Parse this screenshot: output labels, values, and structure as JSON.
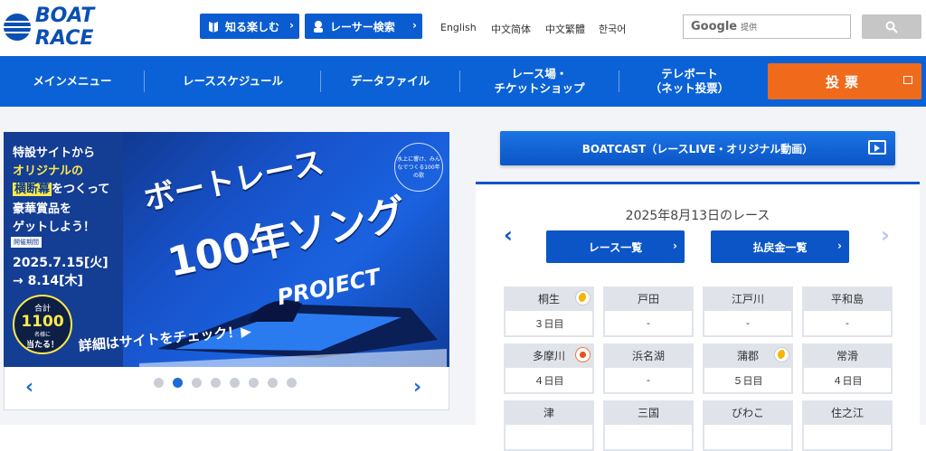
{
  "header": {
    "logo_text": "BOAT RACE",
    "btn_knowledge": "知る楽しむ",
    "btn_racer": "レーサー検索",
    "languages": [
      "English",
      "中文简体",
      "中文繁體",
      "한국어"
    ],
    "search_brand": "Google",
    "search_provided": "提供"
  },
  "nav": {
    "items": [
      "メインメニュー",
      "レーススケジュール",
      "データファイル",
      "レース場・\nチケットショップ",
      "テレボート\n（ネット投票）"
    ],
    "vote": "投票"
  },
  "banner": {
    "line1": "特設サイトから",
    "line2": "オリジナルの",
    "line3a": "横断幕",
    "line3b": "をつくって",
    "line4": "豪華賞品を",
    "line5": "ゲットしよう！",
    "period_label": "開催期間",
    "date_start": "2025.7.15[火]",
    "date_end": "→ 8.14[木]",
    "circle_top": "合計",
    "circle_num": "1100",
    "circle_unit": "名様に",
    "circle_bottom": "当たる！",
    "title1": "ボートレース",
    "title2": "100年ソング",
    "title3": "PROJECT",
    "link": "詳細はサイトをチェック！▶",
    "badge": "水上に響け、みんなでつくる100年の歌",
    "slide_count": 8,
    "active_slide": 2
  },
  "boatcast": "BOATCAST（レースLIVE・オリジナル動画）",
  "races": {
    "date_title": "2025年8月13日のレース",
    "btn_list": "レース一覧",
    "btn_payout": "払戻金一覧",
    "venues": [
      {
        "name": "桐生",
        "day": "３日目",
        "icon": "moon"
      },
      {
        "name": "戸田",
        "day": "-",
        "icon": ""
      },
      {
        "name": "江戸川",
        "day": "-",
        "icon": ""
      },
      {
        "name": "平和島",
        "day": "-",
        "icon": ""
      },
      {
        "name": "多摩川",
        "day": "４日目",
        "icon": "sun"
      },
      {
        "name": "浜名湖",
        "day": "-",
        "icon": ""
      },
      {
        "name": "蒲郡",
        "day": "５日目",
        "icon": "moon"
      },
      {
        "name": "常滑",
        "day": "４日目",
        "icon": ""
      },
      {
        "name": "津",
        "day": "",
        "icon": ""
      },
      {
        "name": "三国",
        "day": "",
        "icon": ""
      },
      {
        "name": "びわこ",
        "day": "",
        "icon": ""
      },
      {
        "name": "住之江",
        "day": "",
        "icon": ""
      }
    ]
  },
  "colors": {
    "brand_blue": "#0b62d6",
    "vote_orange": "#f06a1c",
    "accent_yellow": "#ffe94a"
  }
}
